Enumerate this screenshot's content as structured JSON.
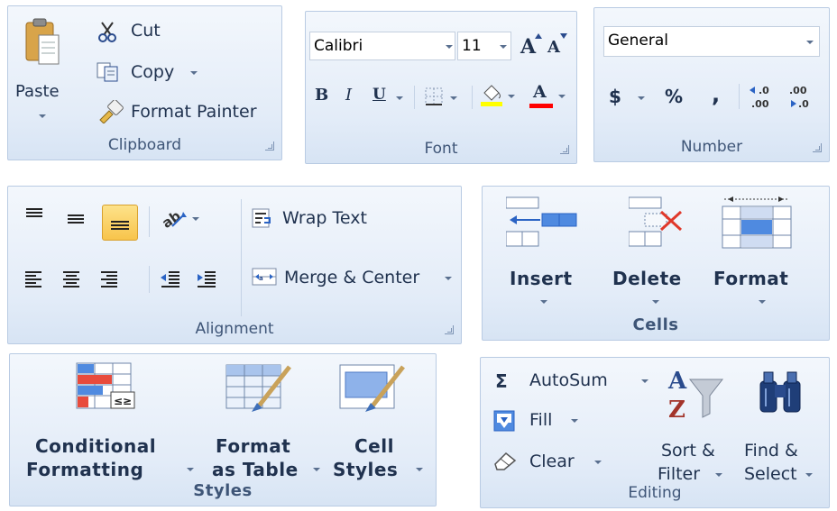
{
  "clipboard": {
    "paste_label": "Paste",
    "cut_label": "Cut",
    "copy_label": "Copy",
    "format_painter_label": "Format Painter",
    "group_label": "Clipboard"
  },
  "font": {
    "font_name": "Calibri",
    "font_size": "11",
    "group_label": "Font",
    "bold": "B",
    "italic": "I",
    "underline": "U",
    "grow": "A",
    "shrink": "A",
    "font_color": "A"
  },
  "number": {
    "format": "General",
    "currency": "$",
    "percent": "%",
    "comma": ",",
    "increase_decimal": ".00",
    "decrease_decimal": ".0",
    "group_label": "Number"
  },
  "alignment": {
    "wrap_text_label": "Wrap Text",
    "merge_center_label": "Merge & Center",
    "group_label": "Alignment"
  },
  "cells": {
    "insert_label": "Insert",
    "delete_label": "Delete",
    "format_label": "Format",
    "group_label": "Cells"
  },
  "styles": {
    "conditional_line1": "Conditional",
    "conditional_line2": "Formatting",
    "format_table_line1": "Format",
    "format_table_line2": "as Table",
    "cell_styles_line1": "Cell",
    "cell_styles_line2": "Styles",
    "group_label": "Styles"
  },
  "editing": {
    "autosum_label": "AutoSum",
    "sigma": "Σ",
    "fill_label": "Fill",
    "clear_label": "Clear",
    "sort_line1": "Sort &",
    "sort_line2": "Filter",
    "find_line1": "Find &",
    "find_line2": "Select",
    "group_label": "Editing"
  },
  "colors": {
    "highlight": "#ffff00",
    "font_color": "#ff0000",
    "accent": "#2f6fd6"
  }
}
